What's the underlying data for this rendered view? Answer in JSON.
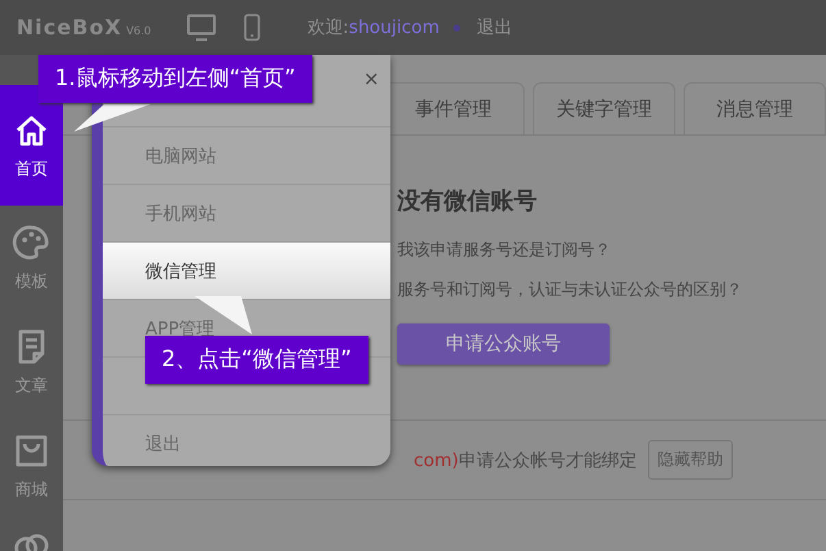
{
  "header": {
    "logo": "NiceBoX",
    "version": "V6.0",
    "welcome": "欢迎:",
    "username": "shoujicom",
    "logout": "退出"
  },
  "sidebar": {
    "items": [
      {
        "kind": "home",
        "label": "首页",
        "selected": true
      },
      {
        "kind": "palette",
        "label": "模板",
        "selected": false
      },
      {
        "kind": "article",
        "label": "文章",
        "selected": false
      },
      {
        "kind": "shop",
        "label": "商城",
        "selected": false
      },
      {
        "kind": "users",
        "selected": false
      }
    ]
  },
  "menu": {
    "close": "×",
    "items": [
      {
        "label": "电脑网站",
        "selected": false
      },
      {
        "label": "手机网站",
        "selected": false
      },
      {
        "label": "微信管理",
        "selected": true
      },
      {
        "label": "APP管理",
        "selected": false
      },
      {
        "selected": false
      },
      {
        "label": "退出",
        "selected": false
      }
    ]
  },
  "tabs": [
    {
      "label": "事件管理",
      "selected": false
    },
    {
      "label": "关键字管理",
      "selected": false
    },
    {
      "label": "消息管理",
      "selected": false
    }
  ],
  "account": {
    "heading": "没有微信账号",
    "questions": [
      "我该申请服务号还是订阅号？",
      "服务号和订阅号，认证与未认证公众号的区别？"
    ],
    "button": "申请公众账号"
  },
  "help": {
    "link": "com)",
    "text": "申请公众帐号才能绑定",
    "button": "隐藏帮助"
  },
  "callouts": [
    {
      "text": "1.鼠标移动到左侧“首页”"
    },
    {
      "text": "2、点击“微信管理”"
    }
  ]
}
